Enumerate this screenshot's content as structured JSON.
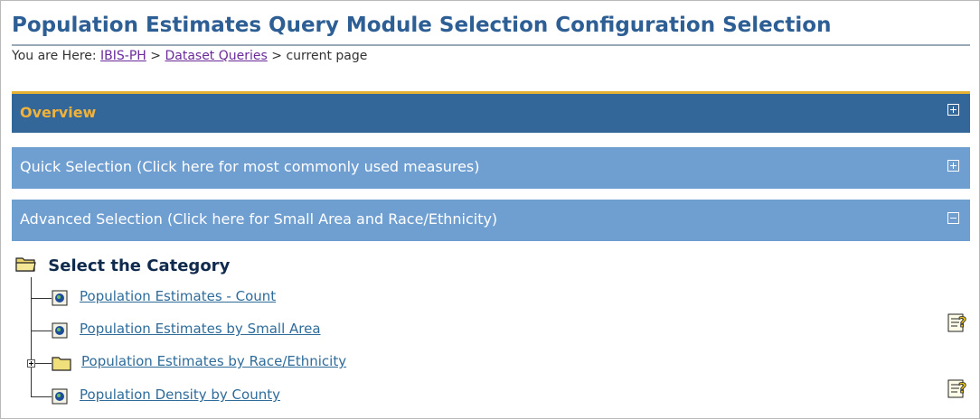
{
  "header": {
    "title": "Population Estimates Query Module Selection Configuration Selection",
    "breadcrumb_prefix": "You are Here:",
    "breadcrumb_sep": ">",
    "breadcrumb_links": [
      "IBIS-PH",
      "Dataset Queries"
    ],
    "breadcrumb_current": "current page"
  },
  "panels": [
    {
      "label": "Overview",
      "state": "collapsed"
    },
    {
      "label": "Quick Selection (Click here for most commonly used measures)",
      "state": "collapsed"
    },
    {
      "label": "Advanced Selection (Click here for Small Area and Race/Ethnicity)",
      "state": "expanded"
    }
  ],
  "tree": {
    "root_label": "Select the Category",
    "items": [
      {
        "label": "Population Estimates - Count",
        "icon": "document-icon",
        "help": false
      },
      {
        "label": "Population Estimates by Small Area",
        "icon": "document-icon",
        "help": true
      },
      {
        "label": "Population Estimates by Race/Ethnicity",
        "icon": "folder-icon",
        "help": false
      },
      {
        "label": "Population Density by County",
        "icon": "document-icon",
        "help": true
      }
    ]
  },
  "colors": {
    "title": "#2d5e94",
    "overview_bg": "#336699",
    "overview_text": "#f0b23a",
    "panel_bg": "#6f9ed1",
    "link": "#2f6c9a"
  }
}
